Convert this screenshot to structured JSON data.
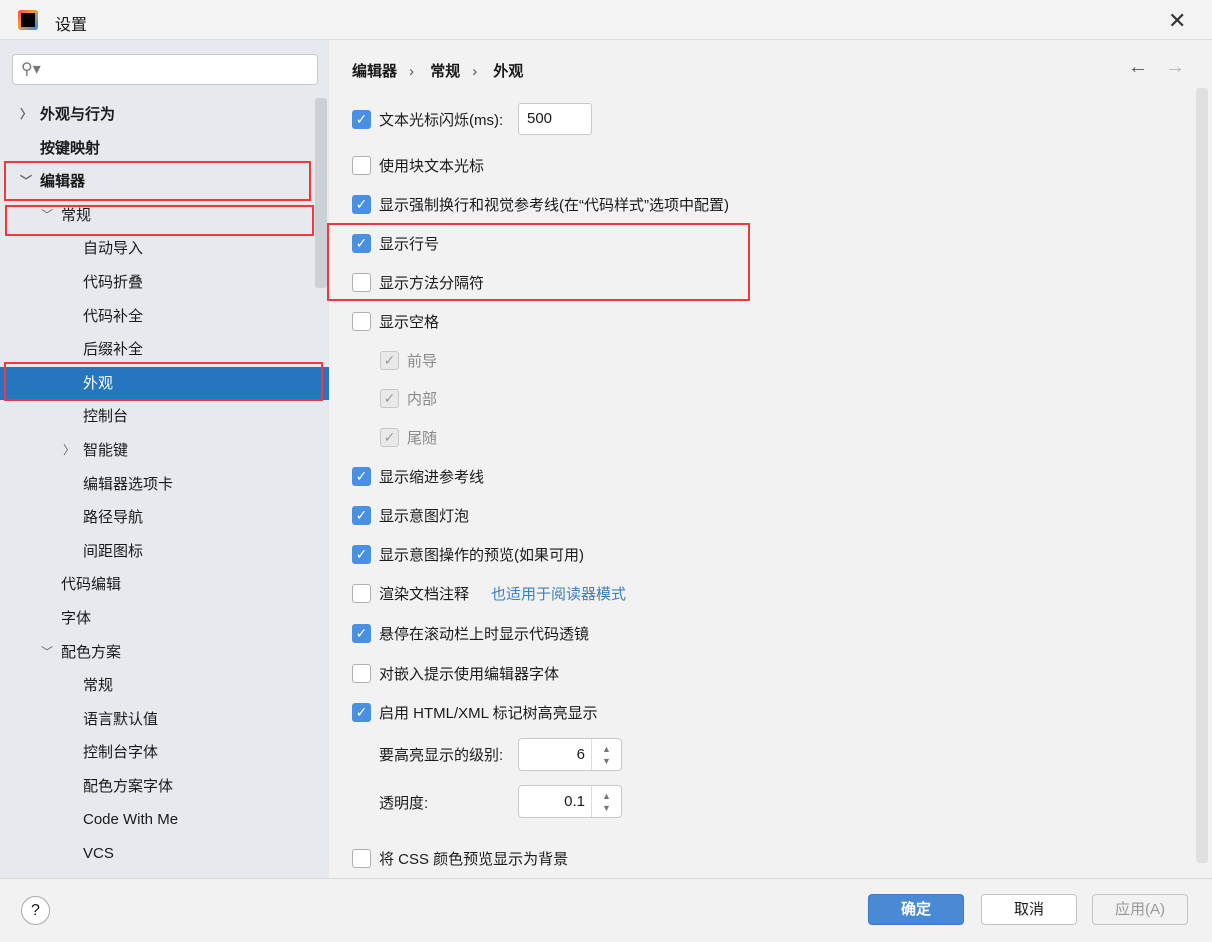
{
  "window": {
    "title": "设置",
    "close_icon": "close-icon"
  },
  "search": {
    "placeholder": "",
    "icon": "search-icon"
  },
  "sidebar": {
    "items": [
      {
        "label": "外观与行为",
        "level": 0,
        "bold": true,
        "chevron": "right"
      },
      {
        "label": "按键映射",
        "level": 0,
        "bold": true,
        "chevron": ""
      },
      {
        "label": "编辑器",
        "level": 0,
        "bold": true,
        "chevron": "down"
      },
      {
        "label": "常规",
        "level": 1,
        "chevron": "down"
      },
      {
        "label": "自动导入",
        "level": 2
      },
      {
        "label": "代码折叠",
        "level": 2
      },
      {
        "label": "代码补全",
        "level": 2
      },
      {
        "label": "后缀补全",
        "level": 2
      },
      {
        "label": "外观",
        "level": 2,
        "selected": true
      },
      {
        "label": "控制台",
        "level": 2
      },
      {
        "label": "智能键",
        "level": 2,
        "chevron": "right"
      },
      {
        "label": "编辑器选项卡",
        "level": 2
      },
      {
        "label": "路径导航",
        "level": 2
      },
      {
        "label": "间距图标",
        "level": 2
      },
      {
        "label": "代码编辑",
        "level": 1
      },
      {
        "label": "字体",
        "level": 1
      },
      {
        "label": "配色方案",
        "level": 1,
        "chevron": "down"
      },
      {
        "label": "常规",
        "level": 2
      },
      {
        "label": "语言默认值",
        "level": 2
      },
      {
        "label": "控制台字体",
        "level": 2
      },
      {
        "label": "配色方案字体",
        "level": 2
      },
      {
        "label": "Code With Me",
        "level": 2
      },
      {
        "label": "VCS",
        "level": 2
      }
    ]
  },
  "breadcrumb": [
    "编辑器",
    "常规",
    "外观"
  ],
  "options": [
    {
      "label": "文本光标闪烁(ms):",
      "checked": true,
      "value": "500"
    },
    {
      "label": "使用块文本光标",
      "checked": false
    },
    {
      "label": "显示强制换行和视觉参考线(在“代码样式”选项中配置)",
      "checked": true
    },
    {
      "label": "显示行号",
      "checked": true
    },
    {
      "label": "显示方法分隔符",
      "checked": false
    },
    {
      "label": "显示空格",
      "checked": false
    },
    {
      "label": "前导",
      "checked": true,
      "disabled": true
    },
    {
      "label": "内部",
      "checked": true,
      "disabled": true
    },
    {
      "label": "尾随",
      "checked": true,
      "disabled": true
    },
    {
      "label": "显示缩进参考线",
      "checked": true
    },
    {
      "label": "显示意图灯泡",
      "checked": true
    },
    {
      "label": "显示意图操作的预览(如果可用)",
      "checked": true
    },
    {
      "label": "渲染文档注释",
      "checked": false,
      "hint": "也适用于阅读器模式"
    },
    {
      "label": "悬停在滚动栏上时显示代码透镜",
      "checked": true
    },
    {
      "label": "对嵌入提示使用编辑器字体",
      "checked": false
    },
    {
      "label": "启用 HTML/XML 标记树高亮显示",
      "checked": true
    },
    {
      "label": "将 CSS 颜色预览显示为背景",
      "checked": false
    }
  ],
  "spinners": [
    {
      "label": "要高亮显示的级别:",
      "value": "6"
    },
    {
      "label": "透明度:",
      "value": "0.1"
    }
  ],
  "footer": {
    "help": "?",
    "ok": "确定",
    "cancel": "取消",
    "apply": "应用(A)"
  },
  "colors": {
    "accent": "#2675bf",
    "checkbox": "#4a90e2",
    "annotation": "#f0393c",
    "link": "#3b7fc4"
  }
}
